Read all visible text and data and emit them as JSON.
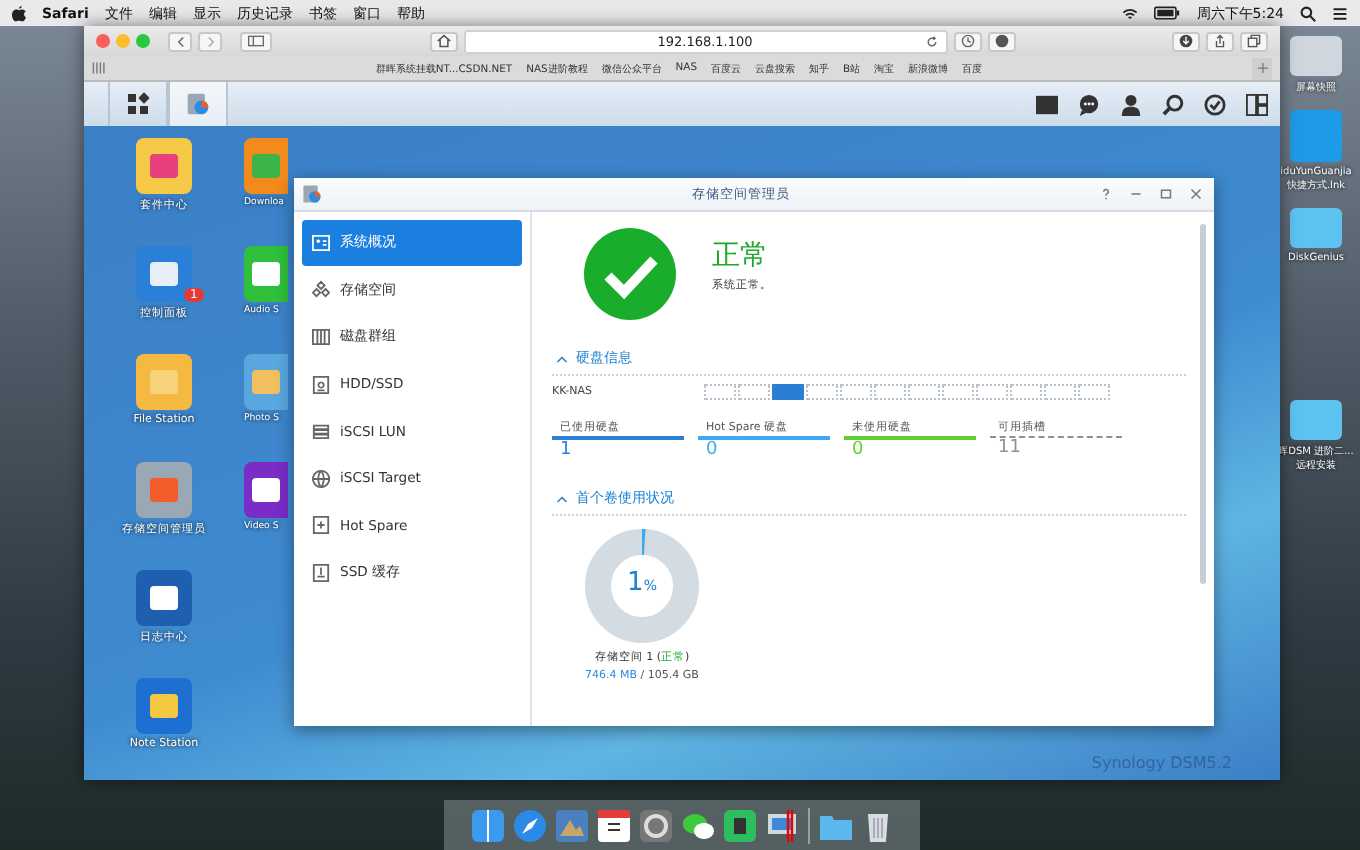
{
  "menubar": {
    "app": "Safari",
    "menus": [
      "文件",
      "编辑",
      "显示",
      "历史记录",
      "书签",
      "窗口",
      "帮助"
    ],
    "clock": "周六下午5:24"
  },
  "browser": {
    "url": "192.168.1.100",
    "bookmarks": [
      "群晖系统挂载NT...CSDN.NET",
      "NAS进阶教程",
      "微信公众平台",
      "NAS",
      "百度云",
      "云盘搜索",
      "知乎",
      "B站",
      "淘宝",
      "新浪微博",
      "百度"
    ]
  },
  "dsm": {
    "desktop_columns": [
      {
        "icons": [
          {
            "kind": "package",
            "label": "套件中心"
          },
          {
            "kind": "control",
            "label": "控制面板",
            "badge": "1"
          },
          {
            "kind": "folder",
            "label": "File Station"
          },
          {
            "kind": "storage",
            "label": "存储空间管理员"
          },
          {
            "kind": "log",
            "label": "日志中心"
          },
          {
            "kind": "note",
            "label": "Note Station"
          }
        ]
      },
      {
        "icons": [
          {
            "kind": "download",
            "label": "Downloa"
          },
          {
            "kind": "audio",
            "label": "Audio S"
          },
          {
            "kind": "photo",
            "label": "Photo S"
          },
          {
            "kind": "video",
            "label": "Video S"
          }
        ]
      }
    ],
    "brand": "Synology DSM5.2"
  },
  "storage_window": {
    "title": "存储空间管理员",
    "nav": [
      {
        "kind": "overview",
        "label": "系统概况",
        "selected": true
      },
      {
        "kind": "volume",
        "label": "存储空间",
        "selected": false
      },
      {
        "kind": "group",
        "label": "磁盘群组",
        "selected": false
      },
      {
        "kind": "hdd",
        "label": "HDD/SSD",
        "selected": false
      },
      {
        "kind": "lun",
        "label": "iSCSI LUN",
        "selected": false
      },
      {
        "kind": "target",
        "label": "iSCSI Target",
        "selected": false
      },
      {
        "kind": "spare",
        "label": "Hot Spare",
        "selected": false
      },
      {
        "kind": "cache",
        "label": "SSD 缓存",
        "selected": false
      }
    ],
    "status": {
      "title": "正常",
      "text": "系统正常。"
    },
    "disk_info": {
      "title": "硬盘信息",
      "device": "KK-NAS",
      "slots": [
        {
          "on": false
        },
        {
          "on": false
        },
        {
          "on": true
        },
        {
          "on": false
        },
        {
          "on": false
        },
        {
          "on": false
        },
        {
          "on": false
        },
        {
          "on": false
        },
        {
          "on": false
        },
        {
          "on": false
        },
        {
          "on": false
        },
        {
          "on": false
        }
      ],
      "stats": [
        {
          "label": "已使用硬盘",
          "value": "1",
          "color": "#2b7fd4",
          "kind": "solid"
        },
        {
          "label": "Hot Spare 硬盘",
          "value": "0",
          "color": "#3fa9f5",
          "kind": "solid"
        },
        {
          "label": "未使用硬盘",
          "value": "0",
          "color": "#66cc33",
          "kind": "solid"
        },
        {
          "label": "可用插槽",
          "value": "11",
          "color": "#8a9199",
          "kind": "dashed"
        }
      ]
    },
    "volume_usage": {
      "title": "首个卷使用状况",
      "level": 0.01,
      "percent": "1",
      "unit": "%",
      "name": "存储空间 1 (",
      "status": "正常",
      "name_end": ")",
      "used": "746.4 MB",
      "total": "/ 105.4 GB"
    }
  },
  "mac_desktop": {
    "icons": [
      {
        "kind": "screenshot",
        "label": "屏幕快照"
      },
      {
        "kind": "app",
        "label": "iduYunGuanjia\n快捷方式.lnk"
      },
      {
        "kind": "folder",
        "label": "DiskGenius"
      },
      {
        "kind": "folder",
        "label": "晖DSM 进阶二...远程安装"
      }
    ]
  }
}
